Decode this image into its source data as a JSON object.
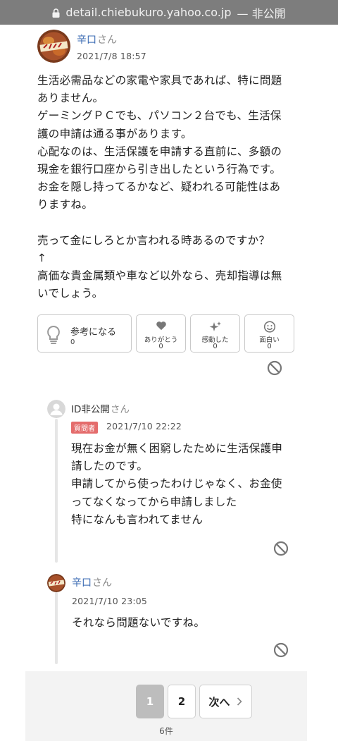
{
  "browser": {
    "url": "detail.chiebukuro.yahoo.co.jp",
    "separator": "—",
    "mode": "非公開"
  },
  "answer": {
    "author": "辛口",
    "honorific": "さん",
    "date": "2021/7/8 18:57",
    "body": "生活必需品などの家電や家具であれば、特に問題\nありません。\nゲーミングＰＣでも、パソコン２台でも、生活保\n護の申請は通る事があります。\n心配なのは、生活保護を申請する直前に、多額の\n現金を銀行口座から引き出したという行為です。\nお金を隠し持ってるかなど、疑われる可能性はあ\nりますね。\n\n売って金にしろとか言われる時あるのですか？\n↑\n高価な貴金属類や車など以外なら、売却指導は無\nいでしょう。"
  },
  "reactions": {
    "helpful": {
      "label": "参考になる",
      "count": "0",
      "icon": "lightbulb-icon"
    },
    "thanks": {
      "label": "ありがとう",
      "count": "0",
      "icon": "heart-icon"
    },
    "moved": {
      "label": "感動した",
      "count": "0",
      "icon": "sparkle-icon"
    },
    "funny": {
      "label": "面白い",
      "count": "0",
      "icon": "smile-icon"
    }
  },
  "replies": [
    {
      "author": "ID非公開",
      "honorific": "さん",
      "badge": "質問者",
      "date": "2021/7/10 22:22",
      "body": "現在お金が無く困窮したために生活保護申\n請したのです。\n申請してから使ったわけじゃなく、お金使\nってなくなってから申請しました\n特になんも言われてません"
    },
    {
      "author": "辛口",
      "honorific": "さん",
      "date": "2021/7/10 23:05",
      "body": "それなら問題ないですね。"
    }
  ],
  "pagination": {
    "pages": [
      "1",
      "2"
    ],
    "current": "1",
    "next_label": "次へ",
    "next_icon": "chevron-right-icon",
    "total": "6件"
  },
  "colors": {
    "author_link": "#3b6bb3",
    "asker_badge": "#e46c6c",
    "url_bar": "#7d7d7d"
  }
}
